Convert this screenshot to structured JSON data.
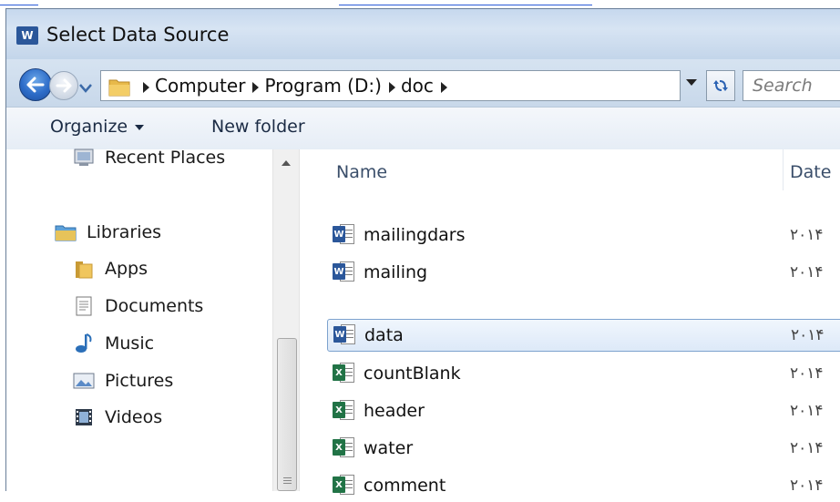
{
  "window": {
    "title": "Select Data Source",
    "title_icon_letter": "W"
  },
  "address": {
    "crumbs": [
      "Computer",
      "Program (D:)",
      "doc"
    ],
    "search_placeholder": "Search"
  },
  "toolbar": {
    "organize_label": "Organize",
    "new_folder_label": "New folder"
  },
  "nav": {
    "recent_places": "Recent Places",
    "libraries": "Libraries",
    "items": [
      "Apps",
      "Documents",
      "Music",
      "Pictures",
      "Videos"
    ]
  },
  "columns": {
    "name": "Name",
    "date": "Date"
  },
  "files": [
    {
      "name": "mailingdars",
      "type": "word",
      "date": "۲۰۱۴"
    },
    {
      "name": "mailing",
      "type": "word",
      "date": "۲۰۱۴"
    },
    {
      "name": "data",
      "type": "word",
      "date": "۲۰۱۴",
      "selected": true
    },
    {
      "name": "countBlank",
      "type": "excel",
      "date": "۲۰۱۴"
    },
    {
      "name": "header",
      "type": "excel",
      "date": "۲۰۱۴"
    },
    {
      "name": "water",
      "type": "excel",
      "date": "۲۰۱۴"
    },
    {
      "name": "comment",
      "type": "excel",
      "date": "۲۰۱۴"
    }
  ],
  "colors": {
    "accent": "#2b579a",
    "excel": "#217346",
    "selection_border": "#7da2ce"
  }
}
